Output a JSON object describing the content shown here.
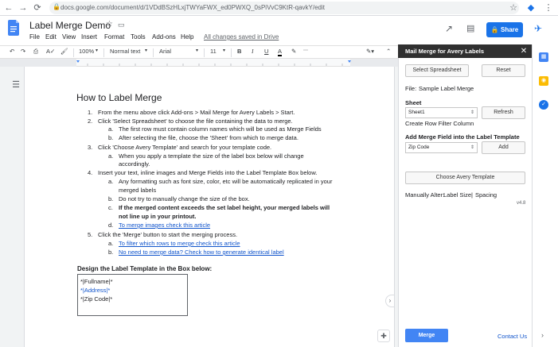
{
  "browser": {
    "url": "docs.google.com/document/d/1VDdBSzHLxjTWYaFWX_ed0PWXQ_0sPiVvC9KtR-qavkY/edit"
  },
  "docs": {
    "title": "Label Merge Demo",
    "menu": [
      "File",
      "Edit",
      "View",
      "Insert",
      "Format",
      "Tools",
      "Add-ons",
      "Help"
    ],
    "saved_status": "All changes saved in Drive",
    "share_label": "Share"
  },
  "toolbar": {
    "zoom": "100%",
    "style": "Normal text",
    "font": "Arial",
    "size": "11"
  },
  "document": {
    "heading": "How to Label Merge",
    "steps": [
      {
        "num": "1.",
        "text": "From the menu above click Add-ons > Mail Merge for Avery Labels > Start."
      },
      {
        "num": "2.",
        "text": "Click 'Select Spreadsheet' to choose the file containing the data to merge."
      },
      {
        "num": "a.",
        "text": "The first row must contain column names which will be used as Merge Fields"
      },
      {
        "num": "b.",
        "text": "After selecting the file, choose the 'Sheet' from which to merge data."
      },
      {
        "num": "3.",
        "text": "Click 'Choose Avery Template' and search for your template code."
      },
      {
        "num": "a.",
        "text": "When you apply a template the size of the label box below will change"
      },
      {
        "num": "",
        "text": "accordingly."
      },
      {
        "num": "4.",
        "text": "Insert your text, inline images and Merge Fields into the Label Template Box below."
      },
      {
        "num": "a.",
        "text": "Any formatting such as font size, color, etc will be automatically replicated in your"
      },
      {
        "num": "",
        "text": "merged labels"
      },
      {
        "num": "b.",
        "text": "Do not try to manually change the size of the box."
      },
      {
        "num": "c.",
        "text": "If the merged content exceeds the set label height, your merged labels will"
      },
      {
        "num": "",
        "text": "not line up in your printout."
      },
      {
        "num": "d.",
        "text": "To merge images check this article"
      },
      {
        "num": "5.",
        "text": "Click the 'Merge' button to start the merging process."
      },
      {
        "num": "a.",
        "text": "To filter which rows to merge check this article"
      },
      {
        "num": "b.",
        "text": "No need to merge data? Check how to generate identical label"
      }
    ],
    "template_heading": "Design the Label Template in the Box below:",
    "template_lines": [
      "*|Fullname|*",
      "*|Address|*",
      "*|Zip Code|*"
    ]
  },
  "sidebar": {
    "title": "Mail Merge for Avery Labels",
    "select_spreadsheet": "Select Spreadsheet",
    "reset": "Reset",
    "file_label": "File:",
    "file_name": "Sample Label Merge",
    "sheet_label": "Sheet",
    "sheet_value": "Sheet1",
    "refresh": "Refresh",
    "create_filter": "Create Row Filter Column",
    "merge_field_label": "Add Merge Field into the Label Template",
    "merge_field_value": "Zip Code",
    "add": "Add",
    "choose_template": "Choose Avery Template",
    "manually_alter": "Manually Alter:",
    "label_size": "Label Size",
    "separator": "|",
    "spacing": "Spacing",
    "version": "v4.8",
    "merge": "Merge",
    "contact": "Contact Us"
  },
  "colors": {
    "share_blue": "#1a73e8",
    "link_blue": "#1155cc",
    "sidebar_header": "#303030",
    "merge_blue": "#4285f4"
  }
}
